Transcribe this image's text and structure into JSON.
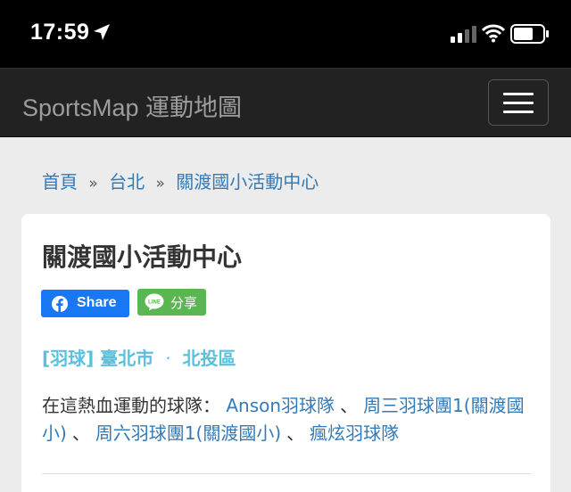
{
  "status_bar": {
    "time": "17:59"
  },
  "navbar": {
    "brand": "SportsMap 運動地圖"
  },
  "breadcrumb": {
    "home": "首頁",
    "sep1": "»",
    "city": "台北",
    "sep2": "»",
    "current": "關渡國小活動中心"
  },
  "venue": {
    "title": "關渡國小活動中心",
    "share_facebook": "Share",
    "share_line": "分享",
    "line_icon_text": "LINE",
    "sport": "[羽球]",
    "city": "臺北市",
    "dot": "·",
    "district": "北投區",
    "teams_label": "在這熱血運動的球隊：",
    "team_sep": "、",
    "teams": [
      "Anson羽球隊",
      "周三羽球團1(關渡國小)",
      "周六羽球團1(關渡國小)",
      "瘋炫羽球隊"
    ]
  },
  "colors": {
    "link": "#337ab7",
    "category": "#5bc0de",
    "facebook": "#1877f2",
    "line": "#5ab650",
    "navbar": "#222222"
  }
}
